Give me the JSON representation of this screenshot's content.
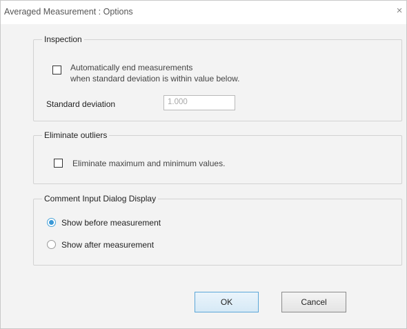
{
  "window": {
    "title": "Averaged Measurement : Options",
    "close_glyph": "×"
  },
  "inspection": {
    "group_title": "Inspection",
    "auto_end_checked": false,
    "auto_end_line1": "Automatically end measurements",
    "auto_end_line2": "when standard deviation is within value below.",
    "std_dev_label": "Standard deviation",
    "std_dev_value": "1.000"
  },
  "outliers": {
    "group_title": "Eliminate outliers",
    "eliminate_checked": false,
    "eliminate_label": "Eliminate maximum and minimum values."
  },
  "comment_dialog": {
    "group_title": "Comment Input Dialog Display",
    "options": [
      {
        "label": "Show before measurement",
        "selected": true
      },
      {
        "label": "Show after measurement",
        "selected": false
      }
    ]
  },
  "buttons": {
    "ok_label": "OK",
    "cancel_label": "Cancel"
  },
  "colors": {
    "accent": "#3a98d6",
    "dialog_background": "#f3f3f3"
  }
}
